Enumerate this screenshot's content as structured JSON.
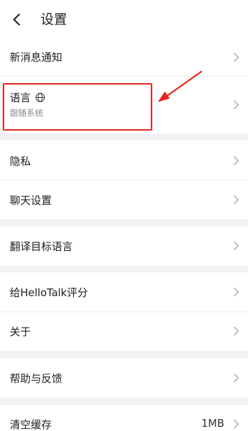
{
  "header": {
    "title": "设置",
    "back_icon": "chevron-left-icon"
  },
  "rows": {
    "notifications": {
      "label": "新消息通知"
    },
    "language": {
      "label": "语言",
      "sublabel": "跟随系统",
      "icon": "globe-icon"
    },
    "privacy": {
      "label": "隐私"
    },
    "chat_settings": {
      "label": "聊天设置"
    },
    "translate_target": {
      "label": "翻译目标语言"
    },
    "rate": {
      "label": "给HelloTalk评分"
    },
    "about": {
      "label": "关于"
    },
    "help_feedback": {
      "label": "帮助与反馈"
    },
    "clear_cache": {
      "label": "清空缓存",
      "value": "1MB"
    }
  },
  "colors": {
    "background": "#ffffff",
    "section_gap": "#f2f2f4",
    "annotation": "#e2241b",
    "chevron": "#b5b5b5"
  }
}
